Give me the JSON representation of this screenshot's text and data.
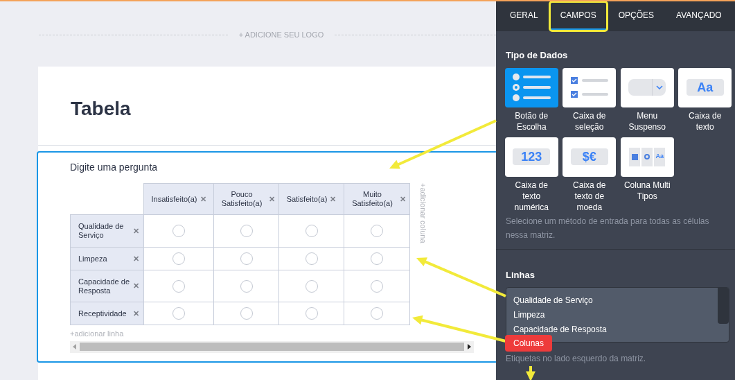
{
  "form": {
    "logo_placeholder": "+ ADICIONE SEU LOGO",
    "title": "Tabela",
    "question": "Digite uma pergunta",
    "columns": [
      "Insatisfeito(a)",
      "Pouco Satisfeito(a)",
      "Satisfeito(a)",
      "Muito Satisfeito(a)"
    ],
    "rows": [
      {
        "label": "Qualidade de Serviço",
        "checked": [
          false,
          false,
          false,
          false
        ]
      },
      {
        "label": "Limpeza",
        "checked": [
          false,
          false,
          false,
          false
        ]
      },
      {
        "label": "Capacidade de Resposta",
        "checked": [
          false,
          false,
          false,
          false
        ]
      },
      {
        "label": "Receptividade",
        "checked": [
          false,
          false,
          false,
          false
        ]
      }
    ],
    "add_column": "+adicionar coluna",
    "add_row": "+adicionar linha",
    "delete_mark": "✕"
  },
  "panel": {
    "tabs": [
      {
        "label": "GERAL",
        "selected": false,
        "highlighted": false
      },
      {
        "label": "CAMPOS",
        "selected": true,
        "highlighted": true
      },
      {
        "label": "OPÇÕES",
        "selected": false,
        "highlighted": false
      },
      {
        "label": "AVANÇADO",
        "selected": false,
        "highlighted": false
      }
    ],
    "data_type": {
      "title": "Tipo de Dados",
      "options": [
        {
          "kind": "radio",
          "label": "Botão de Escolha",
          "selected": true
        },
        {
          "kind": "checkbox",
          "label": "Caixa de seleção",
          "selected": false
        },
        {
          "kind": "dropdown",
          "label": "Menu Suspenso",
          "selected": false
        },
        {
          "kind": "text",
          "label": "Caixa de texto",
          "icon_text": "Aa",
          "selected": false
        },
        {
          "kind": "number",
          "label": "Caixa de texto numérica",
          "icon_text": "123",
          "selected": false
        },
        {
          "kind": "currency",
          "label": "Caixa de texto de moeda",
          "icon_text": "$€",
          "selected": false
        },
        {
          "kind": "multi",
          "label": "Coluna Multi Tipos",
          "icon_text": "Aa",
          "selected": false
        }
      ],
      "hint": "Selecione um método de entrada para todas as células nessa matriz."
    },
    "rows_field": {
      "title": "Linhas",
      "lines": [
        "Qualidade de Serviço",
        "Limpeza",
        "Capacidade de Resposta"
      ],
      "hint": "Etiquetas no lado esquerdo da matriz."
    }
  },
  "annotation": {
    "label": "Colunas"
  }
}
